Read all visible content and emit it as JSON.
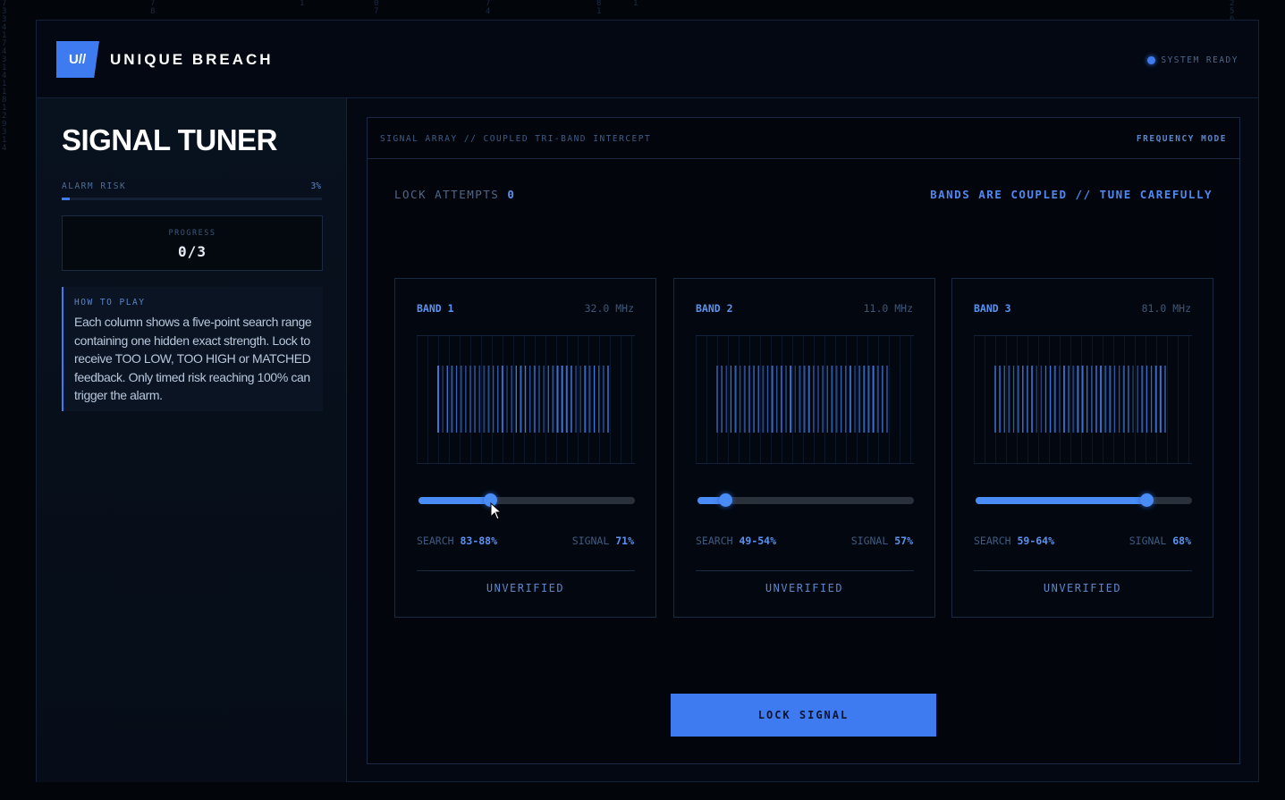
{
  "header": {
    "logo_text": "U//",
    "brand": "UNIQUE BREACH",
    "status": "SYSTEM READY"
  },
  "sidebar": {
    "title": "SIGNAL TUNER",
    "alarm_risk_label": "ALARM RISK",
    "alarm_risk_value": "3%",
    "alarm_risk_fraction": 0.03,
    "progress_label": "PROGRESS",
    "progress_value": "0/3",
    "howto_title": "HOW TO PLAY",
    "howto_text": "Each column shows a five-point search range containing one hidden exact strength. Lock to receive TOO LOW, TOO HIGH or MATCHED feedback. Only timed risk reaching 100% can trigger the alarm."
  },
  "panel": {
    "title": "SIGNAL ARRAY // COUPLED TRI-BAND INTERCEPT",
    "mode": "FREQUENCY MODE",
    "attempts_label": "LOCK ATTEMPTS",
    "attempts_value": "0",
    "notice": "BANDS ARE COUPLED // TUNE CAREFULLY",
    "lock_button": "LOCK SIGNAL"
  },
  "bands": [
    {
      "name": "BAND 1",
      "freq": "32.0 MHz",
      "search_label": "SEARCH",
      "search": "83-88%",
      "signal_label": "SIGNAL",
      "signal": "71%",
      "slider_level": 0.33,
      "status": "UNVERIFIED"
    },
    {
      "name": "BAND 2",
      "freq": "11.0 MHz",
      "search_label": "SEARCH",
      "search": "49-54%",
      "signal_label": "SIGNAL",
      "signal": "57%",
      "slider_level": 0.13,
      "status": "UNVERIFIED"
    },
    {
      "name": "BAND 3",
      "freq": "81.0 MHz",
      "search_label": "SEARCH",
      "search": "59-64%",
      "signal_label": "SIGNAL",
      "signal": "68%",
      "slider_level": 0.79,
      "status": "UNVERIFIED"
    }
  ],
  "colors": {
    "accent": "#3e7bf0",
    "background": "#02050a"
  },
  "icons": {
    "status": "status-dot-icon",
    "cursor": "mouse-pointer-icon"
  }
}
